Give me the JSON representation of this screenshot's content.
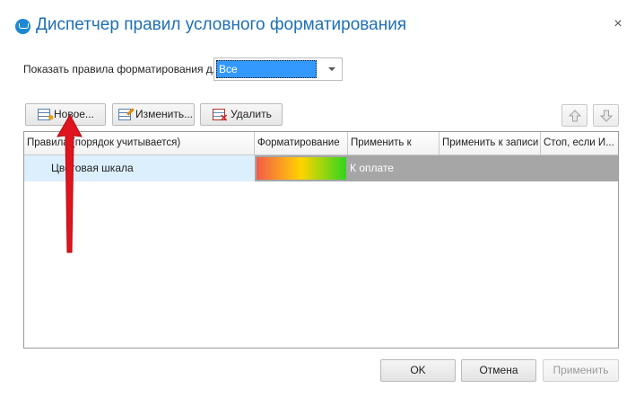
{
  "window": {
    "title": "Диспетчер правил условного форматирования",
    "close_glyph": "×"
  },
  "filter": {
    "label": "Показать правила форматирования для:",
    "selected": "Все"
  },
  "toolbar": {
    "new_label": "Новое...",
    "edit_label": "Изменить...",
    "delete_label": "Удалить"
  },
  "table": {
    "headers": [
      "Правила (порядок учитывается)",
      "Форматирование",
      "Применить к",
      "Применить к записи",
      "Стоп, если И..."
    ],
    "rows": [
      {
        "rule": "Цветовая шкала",
        "apply_to": "К оплате"
      }
    ]
  },
  "footer": {
    "ok_label": "OK",
    "cancel_label": "Отмена",
    "apply_label": "Применить"
  },
  "colors": {
    "title": "#1f6fb5",
    "selection": "#3399ff",
    "row_selected": "#dceffc",
    "row_gray": "#a6a6a6",
    "annotation_arrow": "#e0141e"
  }
}
